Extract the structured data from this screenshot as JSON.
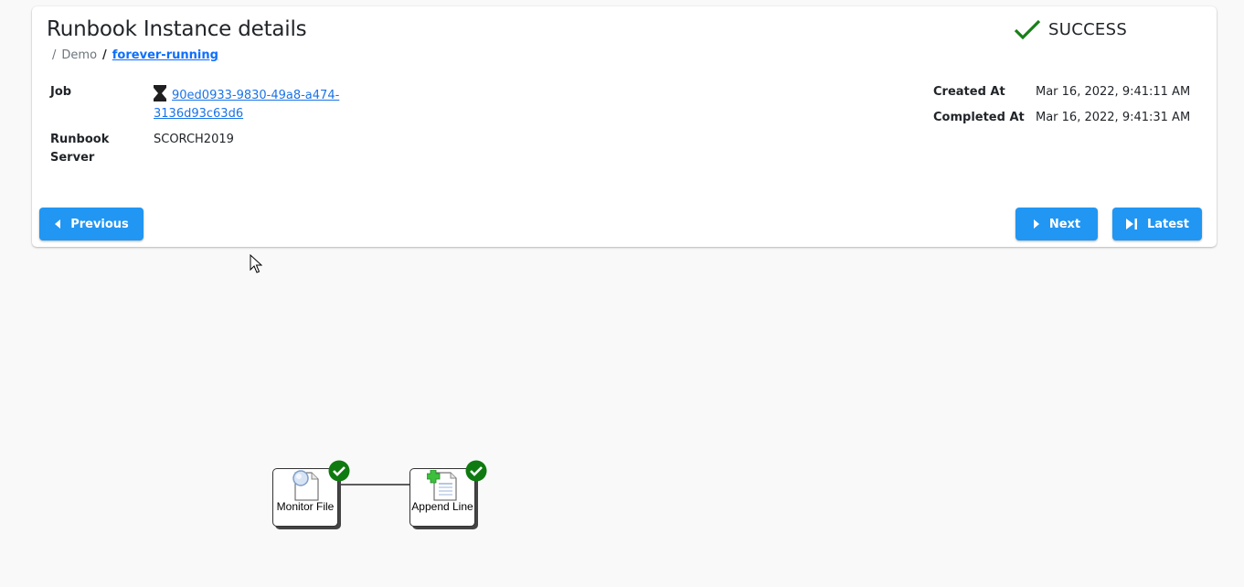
{
  "header": {
    "title": "Runbook Instance details",
    "breadcrumb": [
      {
        "label": "Demo",
        "link": false
      },
      {
        "label": "forever-running",
        "link": true
      }
    ],
    "status": {
      "label": "SUCCESS",
      "icon": "check-icon",
      "color": "#1a7f1a"
    }
  },
  "details_left": [
    {
      "label": "Job",
      "value": "90ed0933-9830-49a8-a474-3136d93c63d6",
      "value_line1": "90ed0933-9830-49a8-a474-",
      "value_line2": "3136d93c63d6",
      "icon": "hourglass-icon",
      "link": true
    },
    {
      "label": "Runbook Server",
      "label_line1": "Runbook",
      "label_line2": "Server",
      "value": "SCORCH2019"
    }
  ],
  "details_right": [
    {
      "label": "Created At",
      "value": "Mar 16, 2022, 9:41:11 AM"
    },
    {
      "label": "Completed At",
      "value": "Mar 16, 2022, 9:41:31 AM"
    }
  ],
  "buttons": {
    "previous": "Previous",
    "next": "Next",
    "latest": "Latest"
  },
  "colors": {
    "accent": "#2196f3",
    "success": "#1a7f1a"
  },
  "diagram": {
    "nodes": [
      {
        "label": "Monitor File",
        "icon": "monitor-file-icon",
        "status": "success"
      },
      {
        "label": "Append Line",
        "icon": "append-line-icon",
        "status": "success"
      }
    ],
    "links": [
      {
        "from": "Monitor File",
        "to": "Append Line"
      }
    ]
  }
}
